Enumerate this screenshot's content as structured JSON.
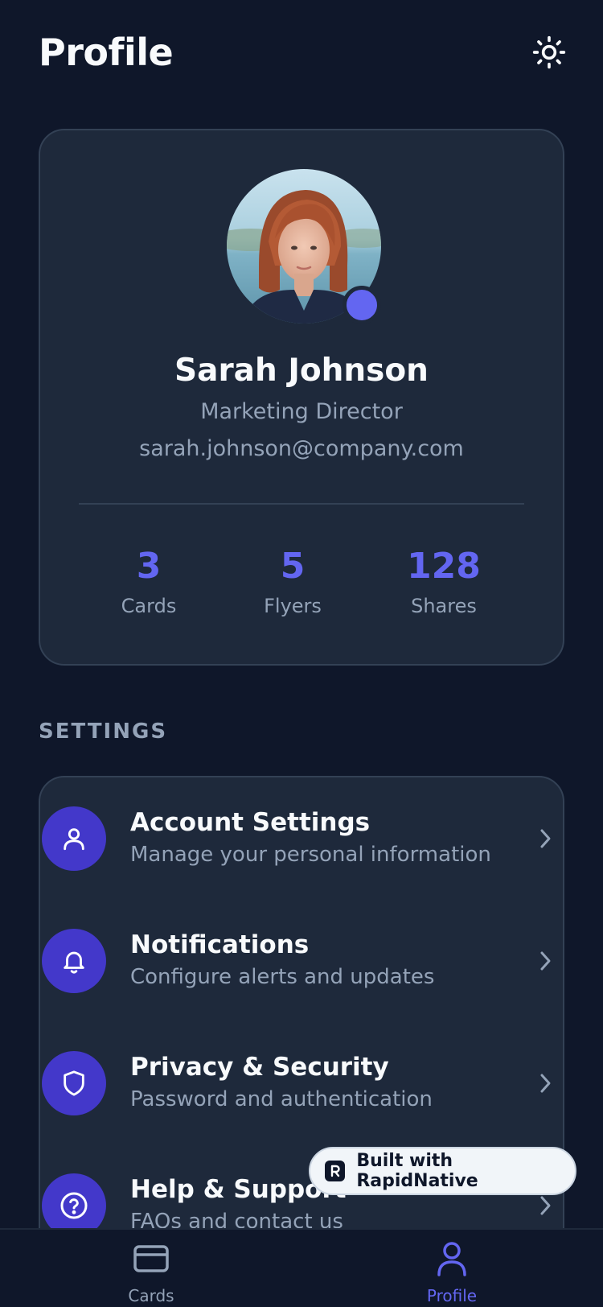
{
  "header": {
    "title": "Profile",
    "theme_icon": "sun-icon"
  },
  "profile": {
    "name": "Sarah Johnson",
    "role": "Marketing Director",
    "email": "sarah.johnson@company.com",
    "status_color": "#6366f1"
  },
  "stats": [
    {
      "value": "3",
      "label": "Cards"
    },
    {
      "value": "5",
      "label": "Flyers"
    },
    {
      "value": "128",
      "label": "Shares"
    }
  ],
  "settings": {
    "section_label": "SETTINGS",
    "items": [
      {
        "title": "Account Settings",
        "subtitle": "Manage your personal information",
        "icon": "user-icon"
      },
      {
        "title": "Notifications",
        "subtitle": "Configure alerts and updates",
        "icon": "bell-icon"
      },
      {
        "title": "Privacy & Security",
        "subtitle": "Password and authentication",
        "icon": "shield-icon"
      },
      {
        "title": "Help & Support",
        "subtitle": "FAQs and contact us",
        "icon": "help-circle-icon"
      }
    ]
  },
  "badge": {
    "label": "Built with RapidNative"
  },
  "nav": {
    "items": [
      {
        "label": "Cards",
        "icon": "credit-card-icon",
        "active": false
      },
      {
        "label": "Profile",
        "icon": "user-icon",
        "active": true
      }
    ]
  },
  "colors": {
    "background": "#0f172a",
    "card": "#1e293b",
    "accent": "#6366f1",
    "icon_bg": "#4338ca",
    "muted": "#94a3b8"
  }
}
